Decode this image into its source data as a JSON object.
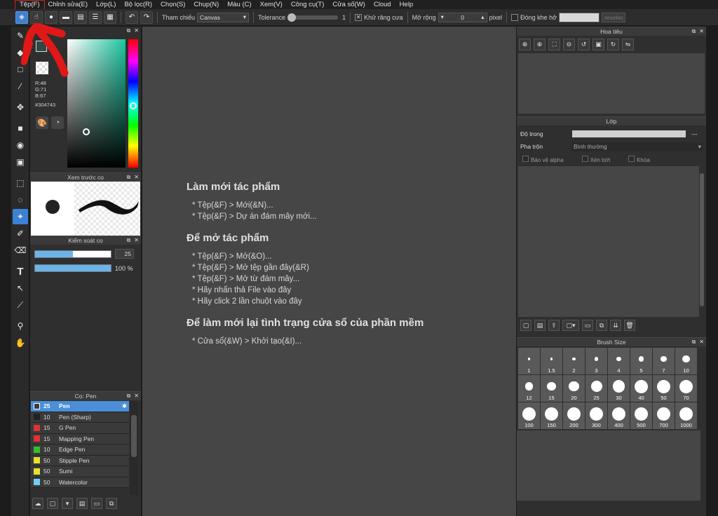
{
  "menu": [
    "Tệp(F)",
    "Chỉnh sửa(E)",
    "Lớp(L)",
    "Bộ lọc(R)",
    "Chọn(S)",
    "Chụp(N)",
    "Màu (C)",
    "Xem(V)",
    "Công cụ(T)",
    "Cửa số(W)",
    "Cloud",
    "Help"
  ],
  "toolbar": {
    "reference_label": "Tham chiếu",
    "reference_value": "Canvas",
    "tolerance_label": "Tolerance",
    "tolerance_value": "1",
    "antialias_label": "Khử răng cưa",
    "expand_label": "Mở rộng",
    "expand_value": "0",
    "expand_unit": "pixel",
    "gap_label": "Đóng khe hở",
    "reselect_label": "reselec"
  },
  "color": {
    "r": "R:48",
    "g": "G:71",
    "b": "B:67",
    "hex": "#304743",
    "fg": "#304743"
  },
  "panels": {
    "preview_title": "Xem trước cọ",
    "brushctl_title": "Kiểm soát cọ",
    "brush_size": "25",
    "brush_opacity": "100 %",
    "brushlist_title": "Cọ: Pen",
    "nav_title": "Hoa tiêu",
    "layer_title": "Lớp",
    "brushsize_title": "Brush Size"
  },
  "brushes": [
    {
      "size": "25",
      "name": "Pen",
      "color": "#3a3a3a",
      "selected": true
    },
    {
      "size": "10",
      "name": "Pen (Sharp)",
      "color": "#222222"
    },
    {
      "size": "15",
      "name": "G Pen",
      "color": "#e03030"
    },
    {
      "size": "15",
      "name": "Mapping Pen",
      "color": "#e03030"
    },
    {
      "size": "10",
      "name": "Edge Pen",
      "color": "#30c030"
    },
    {
      "size": "50",
      "name": "Stipple Pen",
      "color": "#e6e030"
    },
    {
      "size": "50",
      "name": "Sumi",
      "color": "#e6e030"
    },
    {
      "size": "50",
      "name": "Watercolor",
      "color": "#70d0f0"
    }
  ],
  "layer": {
    "opacity_label": "Độ trong",
    "blend_label": "Pha trộn",
    "blend_value": "Bình thường",
    "protect_alpha": "Bảo vệ alpha",
    "clip": "Xén bớt",
    "lock": "Khóa"
  },
  "brush_sizes": [
    "1",
    "1.5",
    "2",
    "3",
    "4",
    "5",
    "7",
    "10",
    "12",
    "15",
    "20",
    "25",
    "30",
    "40",
    "50",
    "70",
    "100",
    "150",
    "200",
    "300",
    "400",
    "500",
    "700",
    "1000"
  ],
  "welcome": {
    "new_title": "Làm mới tác phẩm",
    "new_lines": [
      "* Tệp(&F) > Mới(&N)...",
      "* Tệp(&F) > Dự án đám mây mới..."
    ],
    "open_title": "Để mở tác phẩm",
    "open_lines": [
      "* Tệp(&F) > Mở(&O)...",
      "* Tệp(&F) > Mở tệp gần đây(&R)",
      "* Tệp(&F) > Mở từ đám mây...",
      "* Hãy nhấn thả File vào đây",
      "* Hãy click 2 lần chuột vào đây"
    ],
    "reset_title": "Để làm mới lại tình trạng cửa sổ của phần mềm",
    "reset_lines": [
      "* Cửa sổ(&W) > Khởi tạo(&I)..."
    ]
  }
}
